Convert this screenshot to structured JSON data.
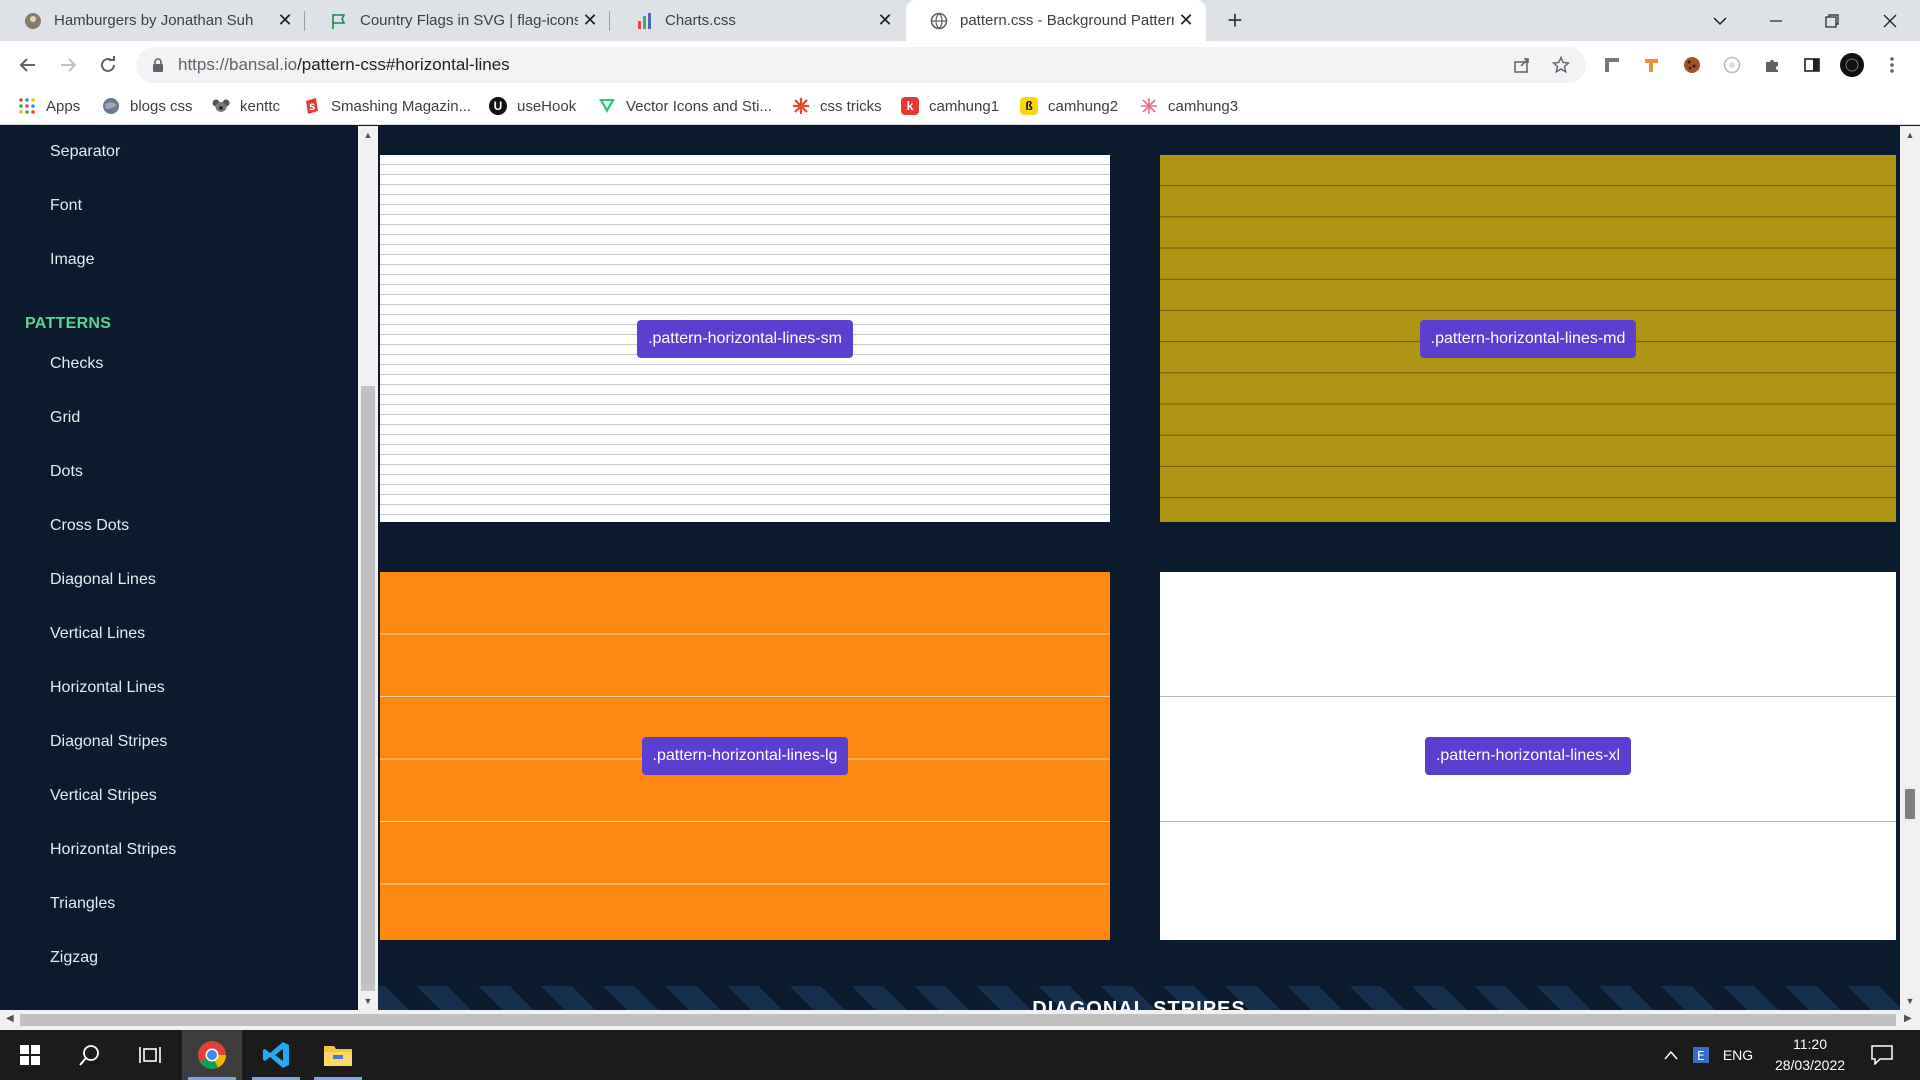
{
  "browser": {
    "tabs": [
      {
        "title": "Hamburgers by Jonathan Suh",
        "icon": "avatar-favicon",
        "active": false
      },
      {
        "title": "Country Flags in SVG | flag-icons",
        "icon": "flag-favicon",
        "active": false
      },
      {
        "title": "Charts.css",
        "icon": "charts-favicon",
        "active": false
      },
      {
        "title": "pattern.css - Background Patterns",
        "icon": "globe-favicon",
        "active": true
      }
    ],
    "close_glyph": "✕",
    "new_tab_glyph": "+",
    "url_host": "https://bansal.io",
    "url_path": "/pattern-css#horizontal-lines",
    "bookmarks": [
      {
        "label": "Apps",
        "icon": "apps-grid-icon"
      },
      {
        "label": "blogs css",
        "icon": "globe-icon"
      },
      {
        "label": "kenttc",
        "icon": "koala-icon"
      },
      {
        "label": "Smashing Magazin...",
        "icon": "smashing-icon"
      },
      {
        "label": "useHook",
        "icon": "usehook-icon",
        "glyph": "U"
      },
      {
        "label": "Vector Icons and Sti...",
        "icon": "vector-icon"
      },
      {
        "label": "css tricks",
        "icon": "css-tricks-icon"
      },
      {
        "label": "camhung1",
        "icon": "camhung1-icon",
        "glyph": "k"
      },
      {
        "label": "camhung2",
        "icon": "camhung2-icon",
        "glyph": "ß"
      },
      {
        "label": "camhung3",
        "icon": "camhung3-icon"
      }
    ]
  },
  "sidebar": {
    "items_top": [
      "Separator",
      "Font",
      "Image"
    ],
    "section_title": "PATTERNS",
    "pattern_items": [
      "Checks",
      "Grid",
      "Dots",
      "Cross Dots",
      "Diagonal Lines",
      "Vertical Lines",
      "Horizontal Lines",
      "Diagonal Stripes",
      "Vertical Stripes",
      "Horizontal Stripes",
      "Triangles",
      "Zigzag"
    ]
  },
  "patterns": {
    "sm": {
      "label": ".pattern-horizontal-lines-sm",
      "bg": "#ffffff",
      "line": "#c8c8c8"
    },
    "md": {
      "label": ".pattern-horizontal-lines-md",
      "bg": "#b09514",
      "line": "#6c5a08"
    },
    "lg": {
      "label": ".pattern-horizontal-lines-lg",
      "bg": "#ff8811",
      "line": "#ffd3a8"
    },
    "xl": {
      "label": ".pattern-horizontal-lines-xl",
      "bg": "#ffffff",
      "line": "#b6b6b6"
    }
  },
  "next_section_heading": "DIAGONAL STRIPES",
  "colors": {
    "page_bg": "#0b1a2c",
    "label_bg": "#5a3fd0",
    "section_green": "#5fd38d"
  },
  "taskbar": {
    "apps": [
      "windows-start-icon",
      "search-icon",
      "task-view-icon",
      "chrome-icon",
      "vscode-icon",
      "file-explorer-icon"
    ],
    "language": "ENG",
    "time": "11:20",
    "date": "28/03/2022"
  }
}
